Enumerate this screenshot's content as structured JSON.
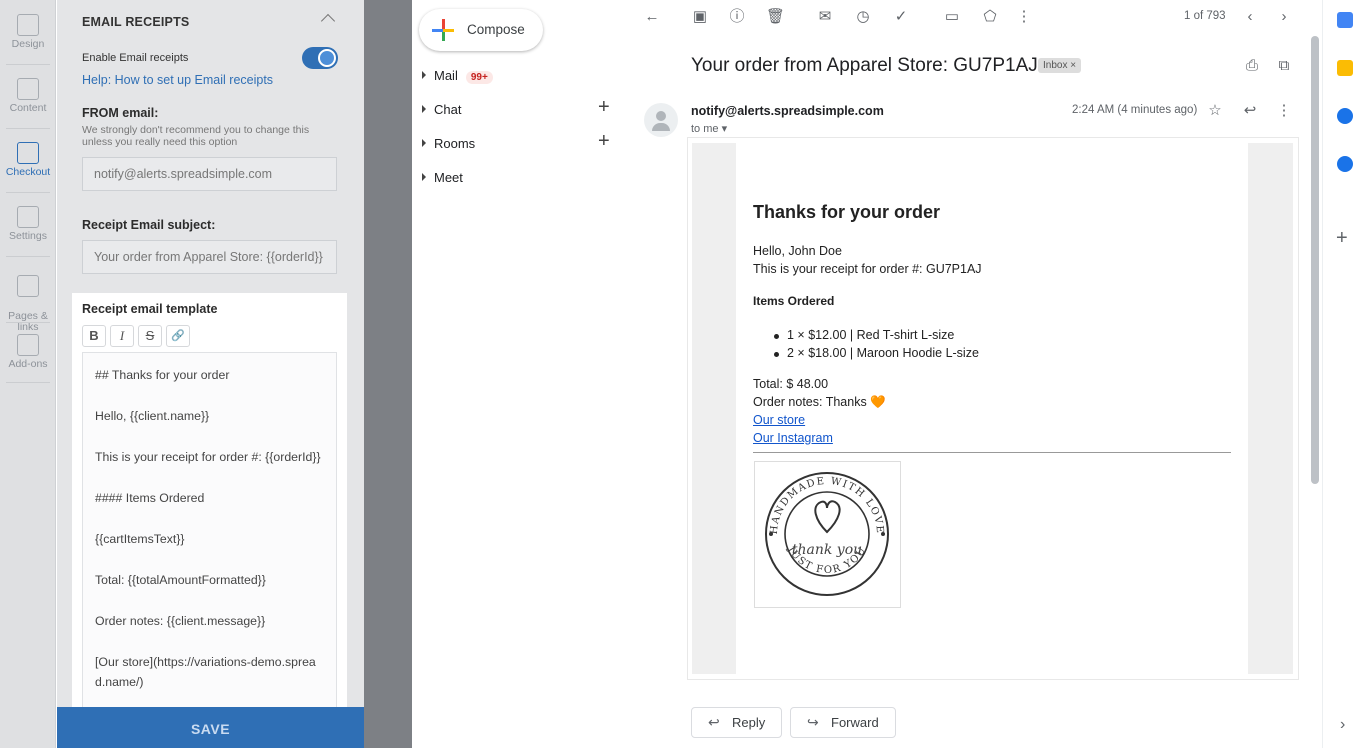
{
  "rail": {
    "items": [
      {
        "label": "Design"
      },
      {
        "label": "Content"
      },
      {
        "label": "Checkout"
      },
      {
        "label": "Settings"
      },
      {
        "label": "Pages &\nlinks"
      },
      {
        "label": "Add-ons"
      }
    ]
  },
  "settings": {
    "section_title": "EMAIL RECEIPTS",
    "enable_label": "Enable Email receipts",
    "enable_on": true,
    "help_link": "Help: How to set up Email receipts",
    "from_label": "FROM email:",
    "from_note": "We strongly don't recommend you to change this unless you really need this option",
    "from_value": "notify@alerts.spreadsimple.com",
    "subject_label": "Receipt Email subject:",
    "subject_value": "Your order from Apparel Store: {{orderId}}",
    "template_label": "Receipt email template",
    "format_buttons": [
      "B",
      "I",
      "S",
      "🔗"
    ],
    "template_lines": [
      "## Thanks for your order",
      "Hello,  {{client.name}}",
      "This is your receipt for order #: {{orderId}}",
      "#### Items Ordered",
      "{{cartItemsText}}",
      "Total: {{totalAmountFormatted}}",
      "Order notes: {{client.message}}",
      "[Our store](https://variations-demo.spread.name/)"
    ],
    "save_label": "SAVE"
  },
  "gmail_nav": {
    "compose": "Compose",
    "mail": "Mail",
    "mail_badge": "99+",
    "chat": "Chat",
    "rooms": "Rooms",
    "meet": "Meet"
  },
  "message": {
    "pager": "1 of 793",
    "subject": "Your order from Apparel Store: GU7P1AJ",
    "label_tag": "Inbox ×",
    "sender": "notify@alerts.spreadsimple.com",
    "to": "to me ▾",
    "time": "2:24 AM (4 minutes ago)",
    "email": {
      "heading": "Thanks for your order",
      "greeting": "Hello, John Doe",
      "receipt_line": "This is your receipt for order #: GU7P1AJ",
      "items_heading": "Items Ordered",
      "items": [
        "1 × $12.00 | Red T-shirt L-size",
        "2 × $18.00 | Maroon Hoodie L-size"
      ],
      "total": "Total: $ 48.00",
      "notes": "Order notes: Thanks 🧡",
      "link_store": "Our store",
      "link_instagram": "Our Instagram",
      "stamp_top": "HANDMADE WITH LOVE",
      "stamp_mid": "thank you",
      "stamp_bottom": "JUST FOR YOU"
    },
    "reply": "Reply",
    "forward": "Forward"
  },
  "colors": {
    "accent_blue": "#2f6fb5",
    "link_blue": "#1155cc",
    "badge_red": "#c5221f"
  }
}
